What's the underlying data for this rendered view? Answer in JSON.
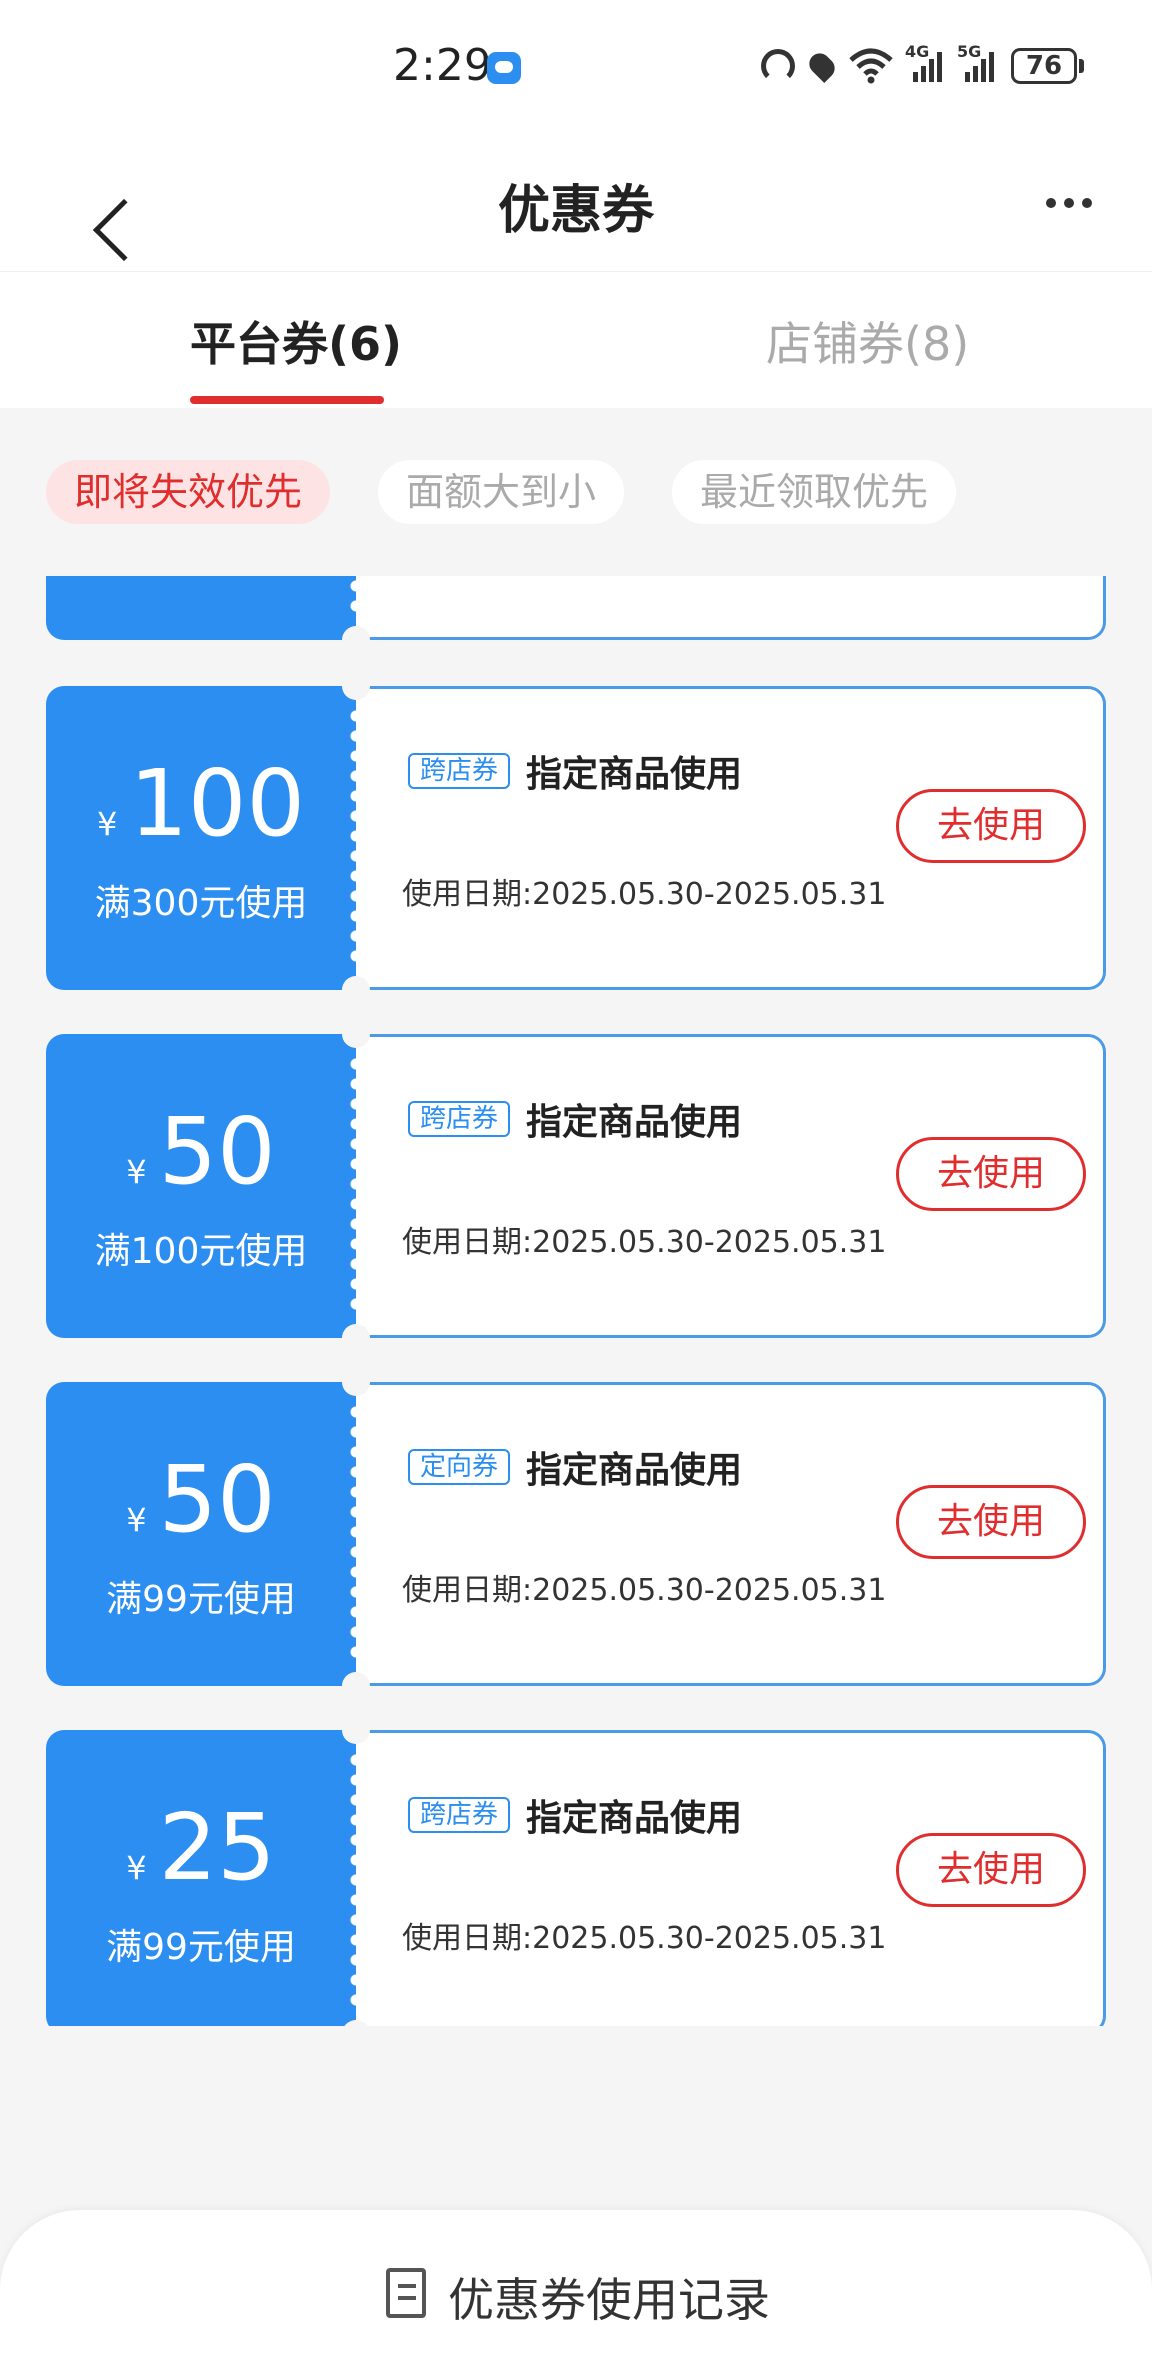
{
  "status_bar": {
    "time": "2:29",
    "battery": "76",
    "signal_4g": "4G",
    "signal_5g": "5G"
  },
  "header": {
    "title": "优惠券"
  },
  "tabs": [
    {
      "label": "平台券(6)",
      "active": true
    },
    {
      "label": "店铺券(8)",
      "active": false
    }
  ],
  "filters": [
    {
      "label": "即将失效优先",
      "active": true
    },
    {
      "label": "面额大到小",
      "active": false
    },
    {
      "label": "最近领取优先",
      "active": false
    }
  ],
  "coupons": [
    {
      "currency": "¥",
      "value": "100",
      "condition": "满300元使用",
      "tag": "跨店券",
      "name": "指定商品使用",
      "date": "使用日期:2025.05.30-2025.05.31",
      "button": "去使用"
    },
    {
      "currency": "¥",
      "value": "50",
      "condition": "满100元使用",
      "tag": "跨店券",
      "name": "指定商品使用",
      "date": "使用日期:2025.05.30-2025.05.31",
      "button": "去使用"
    },
    {
      "currency": "¥",
      "value": "50",
      "condition": "满99元使用",
      "tag": "定向券",
      "name": "指定商品使用",
      "date": "使用日期:2025.05.30-2025.05.31",
      "button": "去使用"
    },
    {
      "currency": "¥",
      "value": "25",
      "condition": "满99元使用",
      "tag": "跨店券",
      "name": "指定商品使用",
      "date": "使用日期:2025.05.30-2025.05.31",
      "button": "去使用"
    }
  ],
  "bottom": {
    "record_label": "优惠券使用记录"
  },
  "colors": {
    "accent_blue": "#2b8ef0",
    "accent_red": "#e02e2e"
  }
}
